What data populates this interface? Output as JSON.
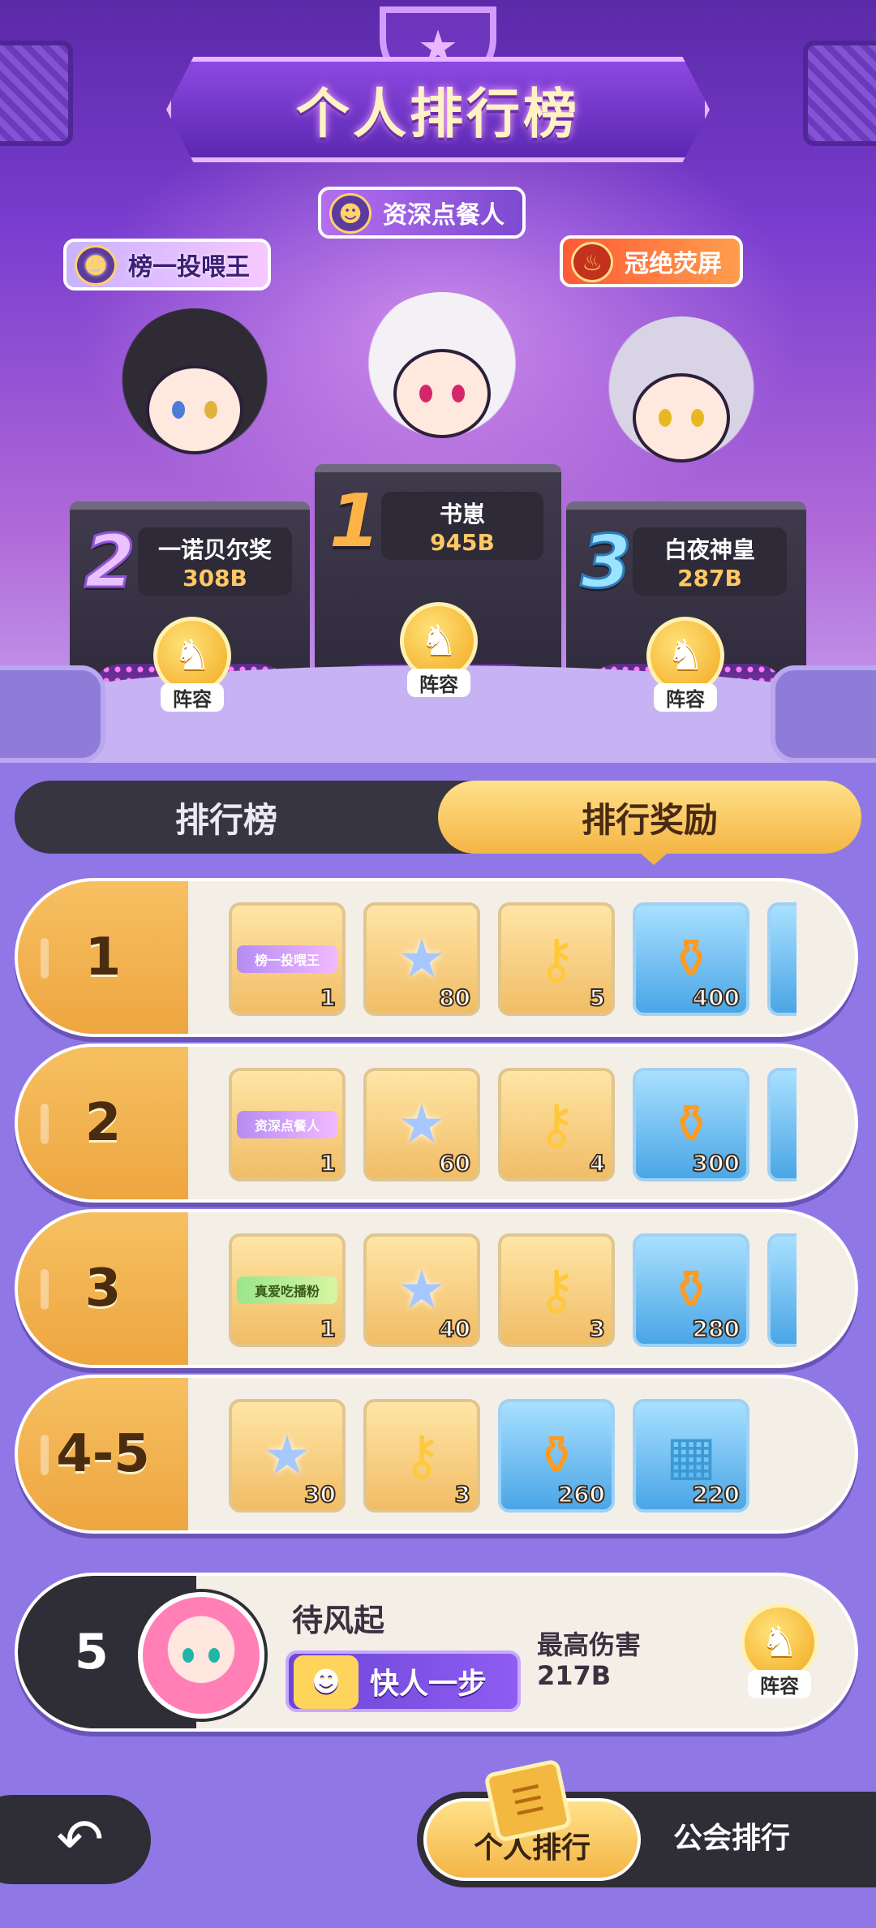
{
  "header": {
    "title": "个人排行榜",
    "trophy_icon": "trophy-star-icon"
  },
  "podium": {
    "center_title_tag": "资深点餐人",
    "left_title_tag": "榜一投喂王",
    "right_title_tag": "冠绝荧屏",
    "entries": [
      {
        "rank": "1",
        "name": "书崽",
        "score": "945B",
        "lineup_label": "阵容"
      },
      {
        "rank": "2",
        "name": "一诺贝尔奖",
        "score": "308B",
        "lineup_label": "阵容"
      },
      {
        "rank": "3",
        "name": "白夜神皇",
        "score": "287B",
        "lineup_label": "阵容"
      }
    ]
  },
  "tabs": {
    "ranking": "排行榜",
    "rewards": "排行奖励",
    "active": "rewards"
  },
  "rewards": [
    {
      "rank": "1",
      "items": [
        {
          "type": "title",
          "icon": "title-badge-icon",
          "label": "榜一投喂王",
          "count": "1"
        },
        {
          "type": "star",
          "icon": "rainbow-star-icon",
          "count": "80"
        },
        {
          "type": "key",
          "icon": "star-key-icon",
          "count": "5"
        },
        {
          "type": "bottle",
          "icon": "mystery-bottle-icon",
          "count": "400"
        }
      ]
    },
    {
      "rank": "2",
      "items": [
        {
          "type": "title",
          "icon": "title-badge-icon",
          "label": "资深点餐人",
          "count": "1"
        },
        {
          "type": "star",
          "icon": "rainbow-star-icon",
          "count": "60"
        },
        {
          "type": "key",
          "icon": "star-key-icon",
          "count": "4"
        },
        {
          "type": "bottle",
          "icon": "mystery-bottle-icon",
          "count": "300"
        }
      ]
    },
    {
      "rank": "3",
      "items": [
        {
          "type": "title",
          "icon": "title-badge-icon",
          "label": "真爱吃播粉",
          "count": "1"
        },
        {
          "type": "star",
          "icon": "rainbow-star-icon",
          "count": "40"
        },
        {
          "type": "key",
          "icon": "star-key-icon",
          "count": "3"
        },
        {
          "type": "bottle",
          "icon": "mystery-bottle-icon",
          "count": "280"
        }
      ]
    },
    {
      "rank": "4-5",
      "items": [
        {
          "type": "star",
          "icon": "rainbow-star-icon",
          "count": "30"
        },
        {
          "type": "key",
          "icon": "star-key-icon",
          "count": "3"
        },
        {
          "type": "bottle",
          "icon": "mystery-bottle-icon",
          "count": "260"
        },
        {
          "type": "map",
          "icon": "map-scroll-icon",
          "count": "220"
        }
      ]
    }
  ],
  "my_rank": {
    "rank": "5",
    "name": "待风起",
    "title": "快人一步",
    "damage_label": "最高伤害",
    "damage_value": "217B",
    "lineup_label": "阵容"
  },
  "bottom_nav": {
    "back_icon": "back-arrow-icon",
    "personal": "个人排行",
    "guild": "公会排行"
  }
}
